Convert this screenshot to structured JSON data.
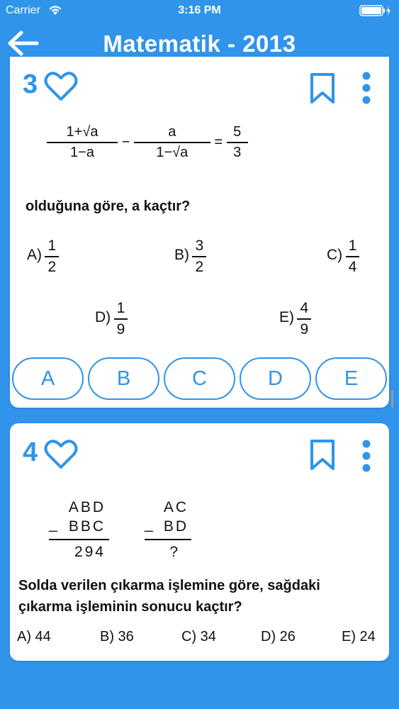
{
  "status_bar": {
    "carrier": "Carrier",
    "time": "3:16 PM"
  },
  "nav": {
    "title": "Matematik - 2013",
    "back_icon": "arrow-left-icon"
  },
  "question1": {
    "number": "3",
    "eq_left_num": "1+√a",
    "eq_left_den": "1−a",
    "eq_minus": "−",
    "eq_mid_num": "a",
    "eq_mid_den": "1−√a",
    "eq_equals": "=",
    "eq_right_num": "5",
    "eq_right_den": "3",
    "prompt": "olduğuna göre,  a  kaçtır?",
    "options": [
      {
        "label": "A)",
        "num": "1",
        "den": "2"
      },
      {
        "label": "B)",
        "num": "3",
        "den": "2"
      },
      {
        "label": "C)",
        "num": "1",
        "den": "4"
      },
      {
        "label": "D)",
        "num": "1",
        "den": "9"
      },
      {
        "label": "E)",
        "num": "4",
        "den": "9"
      }
    ],
    "buttons": [
      "A",
      "B",
      "C",
      "D",
      "E"
    ]
  },
  "question2": {
    "number": "4",
    "left_top": "ABD",
    "left_mid": "BBC",
    "left_res": "294",
    "right_top": "AC",
    "right_mid": "BD",
    "right_res": "?",
    "minus": "_",
    "prompt_line1": "Solda verilen çıkarma işlemine göre, sağdaki",
    "prompt_line2": "çıkarma işleminin sonucu kaçtır?",
    "options": [
      "A) 44",
      "B) 36",
      "C) 34",
      "D) 26",
      "E) 24"
    ]
  },
  "colors": {
    "primary": "#2f94ea",
    "card": "#ffffff"
  }
}
